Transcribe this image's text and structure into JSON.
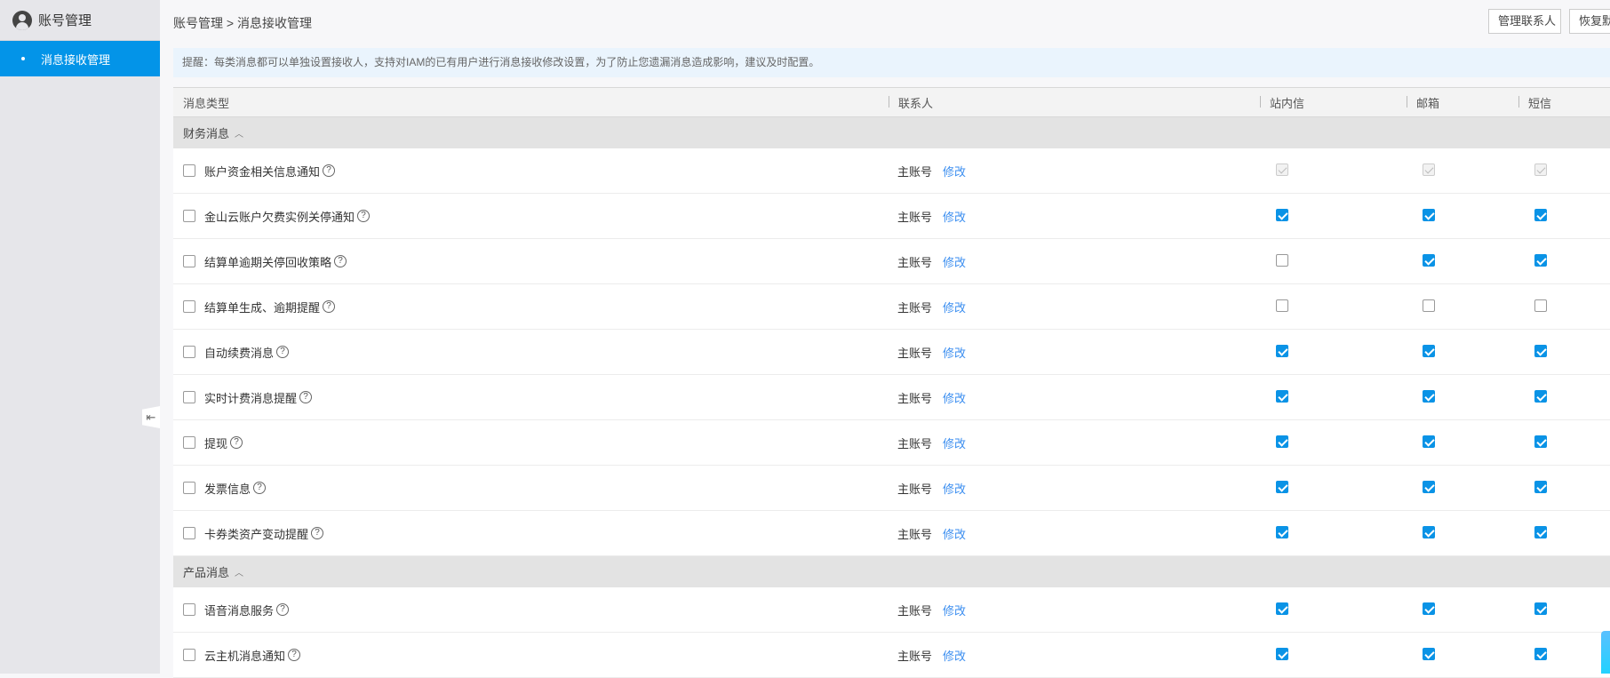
{
  "sidebar": {
    "title": "账号管理",
    "items": [
      {
        "label": "消息接收管理",
        "active": true
      }
    ]
  },
  "breadcrumb": {
    "parent": "账号管理",
    "separator": ">",
    "current": "消息接收管理"
  },
  "buttons": {
    "manage_contacts": "管理联系人",
    "restore_default": "恢复默认"
  },
  "notice": "提醒：每类消息都可以单独设置接收人，支持对IAM的已有用户进行消息接收修改设置，为了防止您遗漏消息造成影响，建议及时配置。",
  "table": {
    "headers": [
      "消息类型",
      "联系人",
      "站内信",
      "邮箱",
      "短信"
    ],
    "groups": [
      {
        "name": "财务消息",
        "rows": [
          {
            "name": "账户资金相关信息通知",
            "contact": "主账号",
            "edit": "修改",
            "inbox": "disabled",
            "email": "disabled",
            "sms": "disabled"
          },
          {
            "name": "金山云账户欠费实例关停通知",
            "contact": "主账号",
            "edit": "修改",
            "inbox": true,
            "email": true,
            "sms": true
          },
          {
            "name": "结算单逾期关停回收策略",
            "contact": "主账号",
            "edit": "修改",
            "inbox": false,
            "email": true,
            "sms": true
          },
          {
            "name": "结算单生成、逾期提醒",
            "contact": "主账号",
            "edit": "修改",
            "inbox": false,
            "email": false,
            "sms": false
          },
          {
            "name": "自动续费消息",
            "contact": "主账号",
            "edit": "修改",
            "inbox": true,
            "email": true,
            "sms": true
          },
          {
            "name": "实时计费消息提醒",
            "contact": "主账号",
            "edit": "修改",
            "inbox": true,
            "email": true,
            "sms": true
          },
          {
            "name": "提现",
            "contact": "主账号",
            "edit": "修改",
            "inbox": true,
            "email": true,
            "sms": true
          },
          {
            "name": "发票信息",
            "contact": "主账号",
            "edit": "修改",
            "inbox": true,
            "email": true,
            "sms": true
          },
          {
            "name": "卡券类资产变动提醒",
            "contact": "主账号",
            "edit": "修改",
            "inbox": true,
            "email": true,
            "sms": true
          }
        ]
      },
      {
        "name": "产品消息",
        "rows": [
          {
            "name": "语音消息服务",
            "contact": "主账号",
            "edit": "修改",
            "inbox": true,
            "email": true,
            "sms": true
          },
          {
            "name": "云主机消息通知",
            "contact": "主账号",
            "edit": "修改",
            "inbox": true,
            "email": true,
            "sms": true
          }
        ]
      }
    ]
  }
}
